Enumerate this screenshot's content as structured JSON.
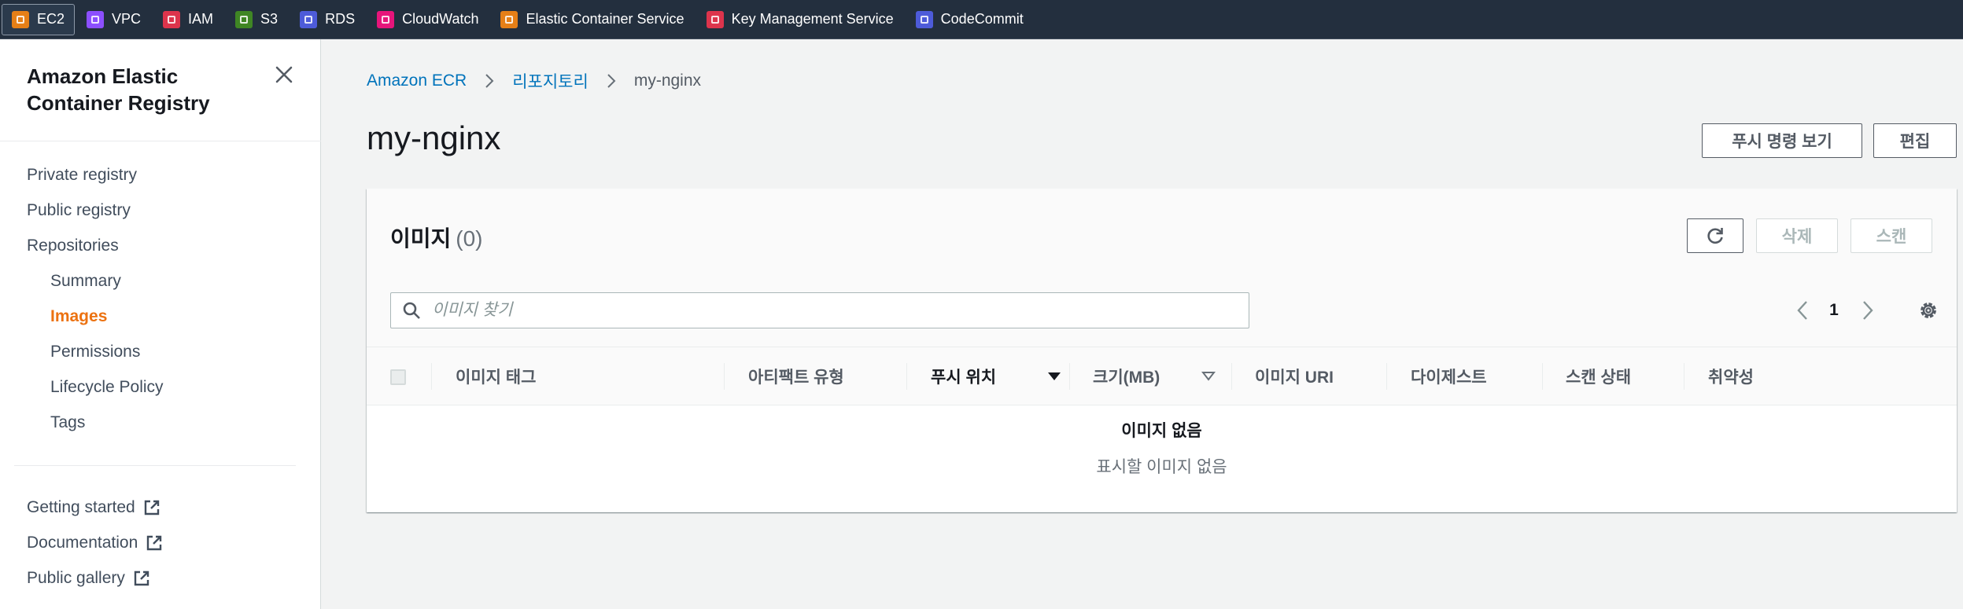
{
  "favorites": [
    {
      "label": "EC2",
      "color": "#e57f17",
      "active": true
    },
    {
      "label": "VPC",
      "color": "#8c4fff"
    },
    {
      "label": "IAM",
      "color": "#dd344c"
    },
    {
      "label": "S3",
      "color": "#3f8624"
    },
    {
      "label": "RDS",
      "color": "#4d5bd9"
    },
    {
      "label": "CloudWatch",
      "color": "#e7157b"
    },
    {
      "label": "Elastic Container Service",
      "color": "#e57f17"
    },
    {
      "label": "Key Management Service",
      "color": "#dd344c"
    },
    {
      "label": "CodeCommit",
      "color": "#4d5bd9"
    }
  ],
  "sidebar": {
    "title": "Amazon Elastic Container Registry",
    "items": {
      "private_registry": "Private registry",
      "public_registry": "Public registry",
      "repositories": "Repositories",
      "summary": "Summary",
      "images": "Images",
      "permissions": "Permissions",
      "lifecycle_policy": "Lifecycle Policy",
      "tags": "Tags",
      "getting_started": "Getting started",
      "documentation": "Documentation",
      "public_gallery": "Public gallery"
    },
    "active_item": "Images",
    "active_color": "#ec7211"
  },
  "breadcrumb": {
    "root": "Amazon ECR",
    "parent": "리포지토리",
    "current": "my-nginx"
  },
  "page": {
    "title": "my-nginx",
    "push_commands_label": "푸시 명령 보기",
    "edit_label": "편집"
  },
  "images_panel": {
    "title": "이미지",
    "count": "(0)",
    "delete_label": "삭제",
    "scan_label": "스캔",
    "search_placeholder": "이미지 찾기",
    "page_number": "1",
    "columns": {
      "image_tag": "이미지 태그",
      "artifact_type": "아티팩트 유형",
      "pushed_at": "푸시 위치",
      "size_mb": "크기(MB)",
      "image_uri": "이미지 URI",
      "digest": "다이제스트",
      "scan_status": "스캔 상태",
      "vulnerabilities": "취약성"
    },
    "empty_title": "이미지 없음",
    "empty_subtitle": "표시할 이미지 없음"
  }
}
